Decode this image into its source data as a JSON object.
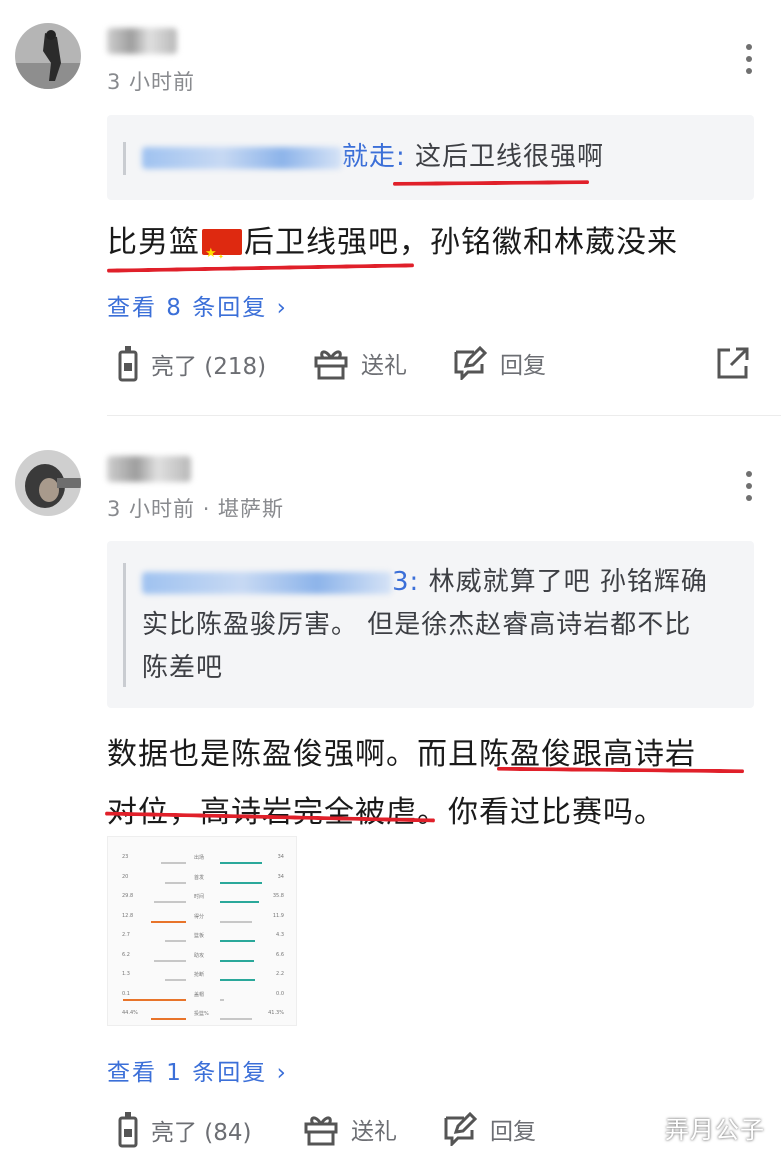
{
  "comments": [
    {
      "username_visible": "",
      "time": "3 小时前",
      "quote": {
        "author_suffix": "就走:",
        "text": "这后卫线很强啊"
      },
      "content_before_flag": "比男篮",
      "content_after_flag": "后卫线强吧，孙铭徽和林葳没来",
      "replies_link": "查看 8 条回复 ›",
      "actions": {
        "like": "亮了 (218)",
        "gift": "送礼",
        "reply": "回复"
      }
    },
    {
      "time": "3 小时前 · 堪萨斯",
      "quote": {
        "author_suffix": "3:",
        "line1": "林威就算了吧 孙铭辉确",
        "line2": "实比陈盈骏厉害。 但是徐杰赵睿高诗岩都不比",
        "line3": "陈差吧"
      },
      "content_line1": "数据也是陈盈俊强啊。而且陈盈俊跟高诗岩",
      "content_line2": "对位，高诗岩完全被虐。你看过比赛吗。",
      "stats_image": {
        "rows": [
          {
            "label": "出场",
            "left": "23",
            "right": "34",
            "lfrac": 0.35,
            "rfrac": 0.6,
            "highlight": "right"
          },
          {
            "label": "首发",
            "left": "20",
            "right": "34",
            "lfrac": 0.3,
            "rfrac": 0.6,
            "highlight": "right"
          },
          {
            "label": "时间",
            "left": "29.8",
            "right": "35.8",
            "lfrac": 0.45,
            "rfrac": 0.55,
            "highlight": "right"
          },
          {
            "label": "得分",
            "left": "12.8",
            "right": "11.9",
            "lfrac": 0.5,
            "rfrac": 0.45,
            "highlight": "left"
          },
          {
            "label": "篮板",
            "left": "2.7",
            "right": "4.3",
            "lfrac": 0.3,
            "rfrac": 0.5,
            "highlight": "right"
          },
          {
            "label": "助攻",
            "left": "6.2",
            "right": "6.6",
            "lfrac": 0.45,
            "rfrac": 0.48,
            "highlight": "right"
          },
          {
            "label": "抢断",
            "left": "1.3",
            "right": "2.2",
            "lfrac": 0.3,
            "rfrac": 0.5,
            "highlight": "right"
          },
          {
            "label": "盖帽",
            "left": "0.1",
            "right": "0.0",
            "lfrac": 0.9,
            "rfrac": 0.05,
            "highlight": "left"
          },
          {
            "label": "投篮%",
            "left": "44.4%",
            "right": "41.3%",
            "lfrac": 0.5,
            "rfrac": 0.45,
            "highlight": "left"
          }
        ]
      },
      "replies_link": "查看 1 条回复 ›",
      "actions": {
        "like": "亮了 (84)",
        "gift": "送礼",
        "reply": "回复"
      }
    }
  ],
  "watermark": "弄月公子",
  "colors": {
    "accent_blue": "#3b6fd8",
    "underline_red": "#e0202a",
    "teal_bar": "#2aa89a",
    "orange_bar": "#e8742a"
  },
  "icons": [
    "more-vert-icon",
    "like-icon",
    "gift-icon",
    "reply-icon",
    "share-icon",
    "china-flag-icon"
  ]
}
